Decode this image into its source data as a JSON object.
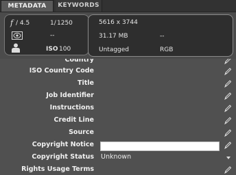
{
  "tabs": [
    {
      "label": "METADATA",
      "active": true
    },
    {
      "label": "KEYWORDS",
      "active": false
    }
  ],
  "camera": {
    "aperture_symbol": "f",
    "aperture_value": "/ 4.5",
    "shutter_prefix": "1/",
    "shutter_value": "1250",
    "metering": "--",
    "iso_label": "ISO",
    "iso_value": "100"
  },
  "file_info": {
    "dimensions": "5616 x 3744",
    "size": "31.17 MB",
    "size_extra": "--",
    "color_profile": "Untagged",
    "color_mode": "RGB"
  },
  "fields": [
    {
      "label": "Country",
      "edit_icon": "pencil-icon"
    },
    {
      "label": "ISO Country Code",
      "edit_icon": "pencil-icon"
    },
    {
      "label": "Title",
      "edit_icon": "pencil-icon"
    },
    {
      "label": "Job Identifier",
      "edit_icon": "pencil-icon"
    },
    {
      "label": "Instructions",
      "edit_icon": "pencil-icon"
    },
    {
      "label": "Credit Line",
      "edit_icon": "pencil-icon"
    },
    {
      "label": "Source",
      "edit_icon": "pencil-icon"
    },
    {
      "label": "Copyright Notice",
      "value": "",
      "edit_icon": "pencil-icon"
    },
    {
      "label": "Copyright Status",
      "value": "Unknown",
      "edit_icon": "chevron-down-icon"
    },
    {
      "label": "Rights Usage Terms",
      "edit_icon": "pencil-icon"
    }
  ],
  "colors": {
    "panel_bg": "#505050",
    "tab_active": "#5a5a5a",
    "box_bg": "#2e2e2e",
    "input_bg": "#ffffff"
  }
}
